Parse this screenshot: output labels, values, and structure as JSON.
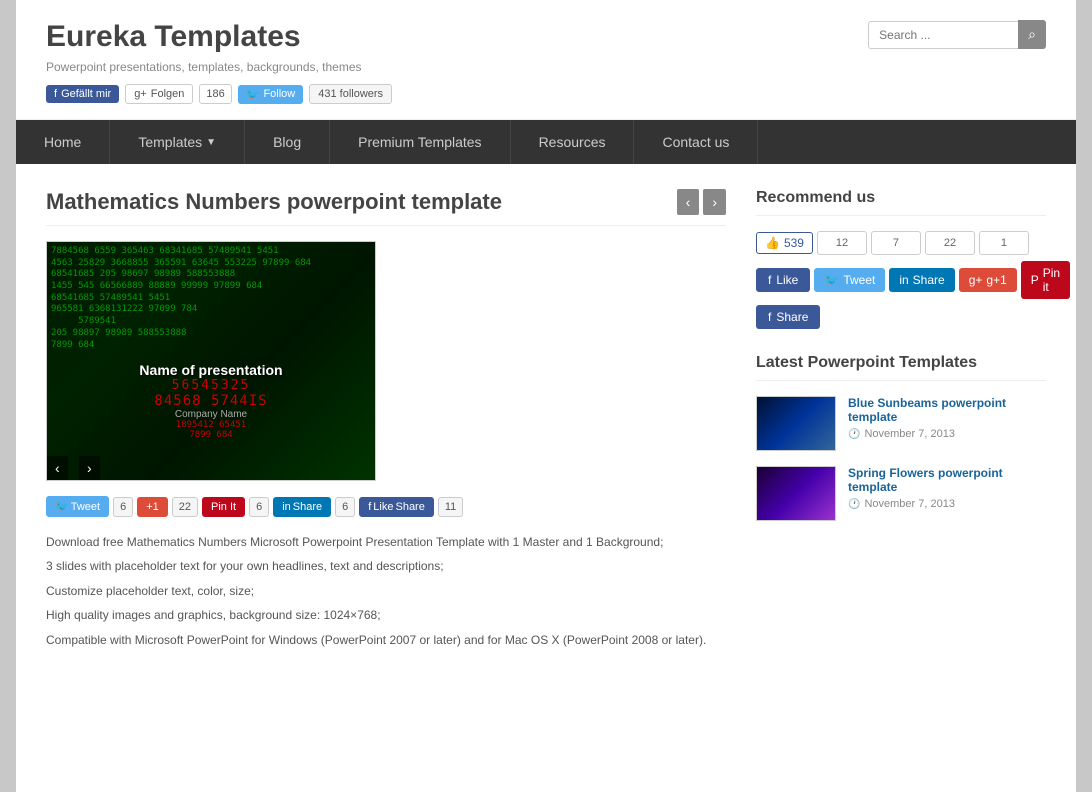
{
  "site": {
    "title": "Eureka Templates",
    "tagline": "Powerpoint presentations, templates, backgrounds, themes"
  },
  "social": {
    "fb_like_label": "Gefällt mir",
    "gplus_label": "Folgen",
    "gplus_count": "186",
    "twitter_follow_label": "Follow",
    "twitter_followers": "431 followers"
  },
  "search": {
    "placeholder": "Search ...",
    "button_label": "🔍"
  },
  "nav": {
    "items": [
      {
        "label": "Home",
        "id": "home"
      },
      {
        "label": "Templates",
        "id": "templates",
        "has_arrow": true
      },
      {
        "label": "Blog",
        "id": "blog"
      },
      {
        "label": "Premium Templates",
        "id": "premium"
      },
      {
        "label": "Resources",
        "id": "resources"
      },
      {
        "label": "Contact us",
        "id": "contact"
      }
    ]
  },
  "post": {
    "title": "Mathematics Numbers powerpoint template",
    "slide_title": "Name of presentation",
    "slide_company": "Company Name",
    "description_lines": [
      "Download free Mathematics Numbers Microsoft Powerpoint Presentation Template with 1 Master and 1 Background;",
      "3 slides with placeholder text for your own headlines, text and descriptions;",
      "Customize placeholder text, color, size;",
      "High quality images and graphics, background size: 1024×768;",
      "Compatible with Microsoft PowerPoint for Windows (PowerPoint 2007 or later) and for Mac OS X (PowerPoint 2008 or later)."
    ]
  },
  "share_bar": {
    "twitter_label": "Tweet",
    "twitter_count": "6",
    "gplus_label": "+1",
    "gplus_count": "22",
    "pinterest_label": "Pin It",
    "pinterest_count": "6",
    "linkedin_label": "Share",
    "linkedin_count": "6",
    "fb_label": "Like",
    "fb_share_label": "Share",
    "fb_count": "11"
  },
  "recommend": {
    "title": "Recommend us",
    "fb_count": "539",
    "fb_like_label": "Like",
    "fb_share_label": "Share",
    "counts": {
      "twitter": "12",
      "linkedin": "7",
      "gplus": "22",
      "pinterest": "1"
    },
    "twitter_label": "Tweet",
    "linkedin_label": "Share",
    "gplus_label": "g+1",
    "pinterest_label": "Pin it"
  },
  "latest": {
    "title": "Latest Powerpoint Templates",
    "items": [
      {
        "title": "Blue Sunbeams powerpoint template",
        "date": "November 7, 2013",
        "thumb_class": "thumb-blue"
      },
      {
        "title": "Spring Flowers powerpoint template",
        "date": "November 7, 2013",
        "thumb_class": "thumb-purple"
      }
    ]
  }
}
